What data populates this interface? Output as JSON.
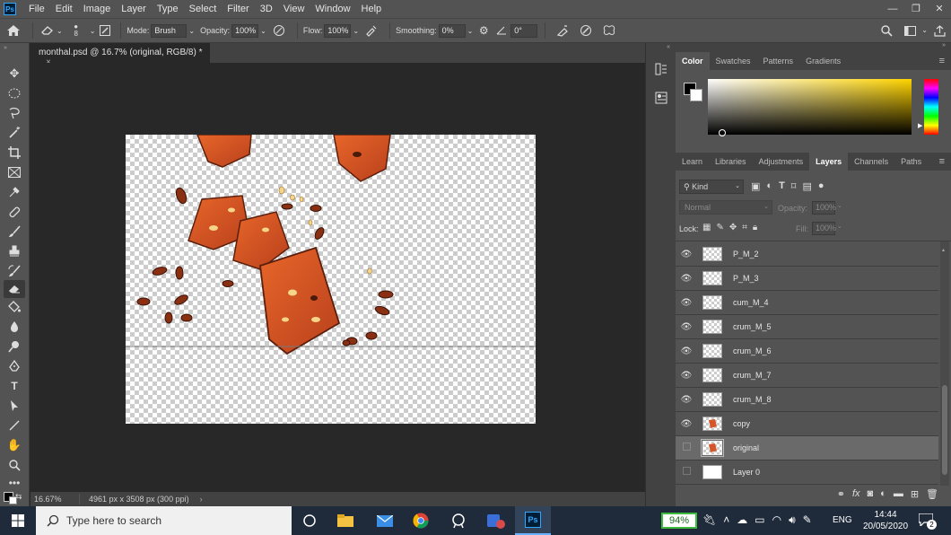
{
  "menubar": {
    "items": [
      "File",
      "Edit",
      "Image",
      "Layer",
      "Type",
      "Select",
      "Filter",
      "3D",
      "View",
      "Window",
      "Help"
    ],
    "app_logo": "Ps"
  },
  "options": {
    "brush_size": "8",
    "mode_label": "Mode:",
    "mode_value": "Brush",
    "opacity_label": "Opacity:",
    "opacity_value": "100%",
    "flow_label": "Flow:",
    "flow_value": "100%",
    "smoothing_label": "Smoothing:",
    "smoothing_value": "0%",
    "angle_value": "0°"
  },
  "document": {
    "tab_title": "monthal.psd @ 16.7% (original, RGB/8) *",
    "close": "×"
  },
  "status": {
    "zoom": "16.67%",
    "info": "4961 px x 3508 px (300 ppi)"
  },
  "color_panel": {
    "tabs": [
      "Color",
      "Swatches",
      "Patterns",
      "Gradients"
    ],
    "active": "Color"
  },
  "layers_panel": {
    "tabs": [
      "Learn",
      "Libraries",
      "Adjustments",
      "Layers",
      "Channels",
      "Paths"
    ],
    "active": "Layers",
    "filter_kind": "Kind",
    "blend_mode": "Normal",
    "opacity_label": "Opacity:",
    "opacity_value": "100%",
    "lock_label": "Lock:",
    "fill_label": "Fill:",
    "fill_value": "100%",
    "layers": [
      {
        "name": "P_M_2",
        "visible": true
      },
      {
        "name": "P_M_3",
        "visible": true
      },
      {
        "name": "cum_M_4",
        "visible": true
      },
      {
        "name": "crum_M_5",
        "visible": true
      },
      {
        "name": "crum_M_6",
        "visible": true
      },
      {
        "name": "crum_M_7",
        "visible": true
      },
      {
        "name": "crum_M_8",
        "visible": true
      },
      {
        "name": "copy",
        "visible": true
      },
      {
        "name": "original",
        "visible": false,
        "selected": true
      },
      {
        "name": "Layer 0",
        "visible": false
      }
    ]
  },
  "taskbar": {
    "search_placeholder": "Type here to search",
    "battery": "94%",
    "language": "ENG",
    "time": "14:44",
    "date": "20/05/2020",
    "notifications": "2"
  }
}
